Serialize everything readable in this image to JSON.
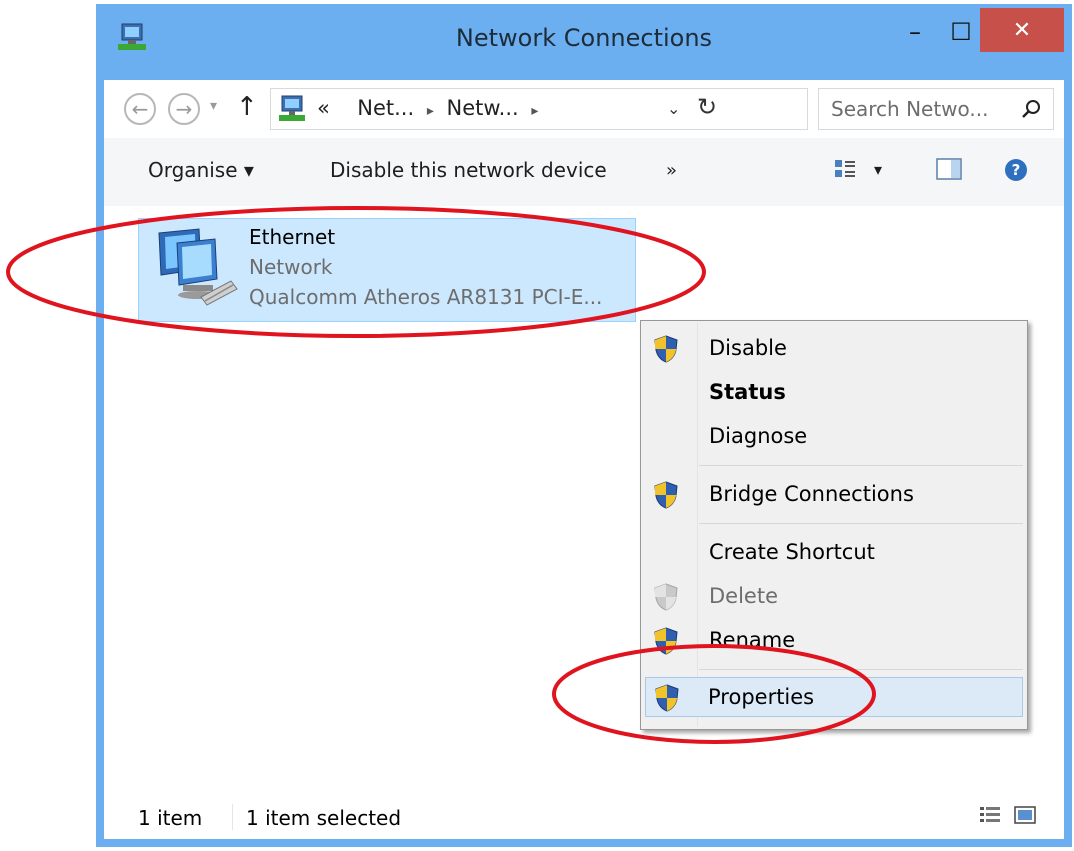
{
  "window": {
    "title": "Network Connections",
    "minimize_glyph": "–",
    "maximize_glyph": "☐",
    "close_glyph": "✕",
    "accent_close": "#c7504a",
    "frame_color": "#6baff0"
  },
  "address": {
    "breadcrumb_prefix": "«",
    "breadcrumb": [
      "Net...",
      "Netw..."
    ],
    "search_placeholder": "Search Netwo..."
  },
  "toolbar": {
    "organise": "Organise ▾",
    "disable_device": "Disable this network device",
    "more": "»"
  },
  "item": {
    "name": "Ethernet",
    "type": "Network",
    "device": "Qualcomm Atheros AR8131 PCI-E..."
  },
  "context_menu": {
    "items": [
      {
        "label": "Disable",
        "shield": true,
        "disabled": false,
        "bold": false
      },
      {
        "label": "Status",
        "shield": false,
        "disabled": false,
        "bold": true
      },
      {
        "label": "Diagnose",
        "shield": false,
        "disabled": false,
        "bold": false
      },
      {
        "label": "Bridge Connections",
        "shield": true,
        "disabled": false,
        "bold": false
      },
      {
        "label": "Create Shortcut",
        "shield": false,
        "disabled": false,
        "bold": false
      },
      {
        "label": "Delete",
        "shield": true,
        "disabled": true,
        "bold": false
      },
      {
        "label": "Rename",
        "shield": true,
        "disabled": false,
        "bold": false
      },
      {
        "label": "Properties",
        "shield": true,
        "disabled": false,
        "bold": false,
        "highlighted": true
      }
    ]
  },
  "status_bar": {
    "count": "1 item",
    "selected": "1 item selected"
  },
  "annotation_color": "#e0141e"
}
